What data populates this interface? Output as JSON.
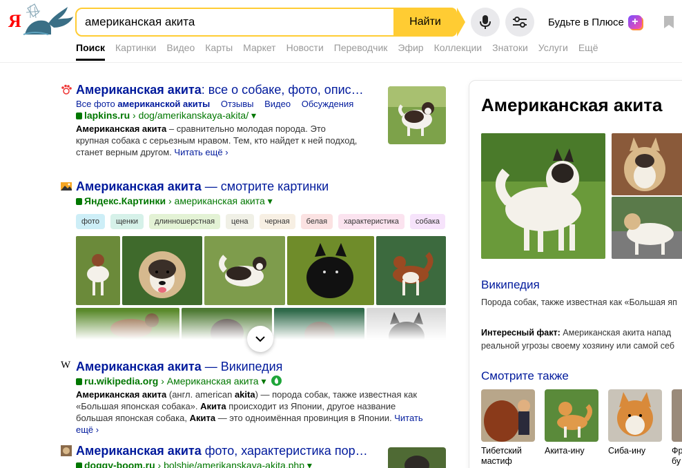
{
  "search": {
    "query": "американская акита",
    "find_label": "Найти",
    "plus_label": "Будьте в Плюсе",
    "logo_letter": "Я"
  },
  "nav": [
    "Поиск",
    "Картинки",
    "Видео",
    "Карты",
    "Маркет",
    "Новости",
    "Переводчик",
    "Эфир",
    "Коллекции",
    "Знатоки",
    "Услуги",
    "Ещё"
  ],
  "results": [
    {
      "title_bold": "Американская акита",
      "title_rest": ": все о собаке, фото, опис…",
      "sitelinks_prefix": "Все фото ",
      "sitelinks_bold": "американской акиты",
      "sitelinks": [
        "Отзывы",
        "Видео",
        "Обсуждения"
      ],
      "domain": "lapkins.ru",
      "path": " › dog/amerikanskaya-akita/ ▾",
      "snippet_bold": "Американская акита",
      "snippet": " – сравнительно молодая порода. Это крупная собака с серьезным нравом. Тем, кто найдет к ней подход, станет верным другом.",
      "more": "Читать ещё ›"
    },
    {
      "title_bold": "Американская акита",
      "title_rest": " — смотрите картинки",
      "domain": "Яндекс.Картинки",
      "path": " › американская акита ▾",
      "tags": [
        "фото",
        "щенки",
        "длинношерстная",
        "цена",
        "черная",
        "белая",
        "характеристика",
        "собака"
      ]
    },
    {
      "title_bold": "Американская акита",
      "title_rest": " — Википедия",
      "domain": "ru.wikipedia.org",
      "path": " › Американская акита ▾",
      "snippet_bold": "Американская акита",
      "snippet_mid": " (англ. american ",
      "snippet_bold2": "akita",
      "snippet_2": ") — порода собак, также известная как «Большая японская собака». ",
      "snippet_bold3": "Акита",
      "snippet_3": " происходит из Японии, другое название большая японская собака, ",
      "snippet_bold4": "Акита",
      "snippet_4": " — это одноимённая провинция в Японии.",
      "more": "Читать ещё ›"
    },
    {
      "title_bold": "Американская акита",
      "title_rest": " фото, характеристика пор…",
      "domain": "doggy-boom.ru",
      "path": " › bolshie/amerikanskaya-akita.php ▾"
    }
  ],
  "panel": {
    "title": "Американская акита",
    "wiki_label": "Википедия",
    "description": "Порода собак, также известная как «Большая яп",
    "fact_label": "Интересный факт:",
    "fact_line1": " Американская акита напад",
    "fact_line2": "реальной угрозы своему хозяину или самой себ",
    "see_also_label": "Смотрите также",
    "see_also": [
      {
        "line1": "Тибетский",
        "line2": "мастиф"
      },
      {
        "line1": "Акита-ину",
        "line2": ""
      },
      {
        "line1": "Сиба-ину",
        "line2": ""
      },
      {
        "line1": "Фр",
        "line2": "бу"
      }
    ]
  },
  "colors": {
    "accent": "#ffcc33",
    "link": "#001a9c",
    "url_green": "#007700"
  }
}
